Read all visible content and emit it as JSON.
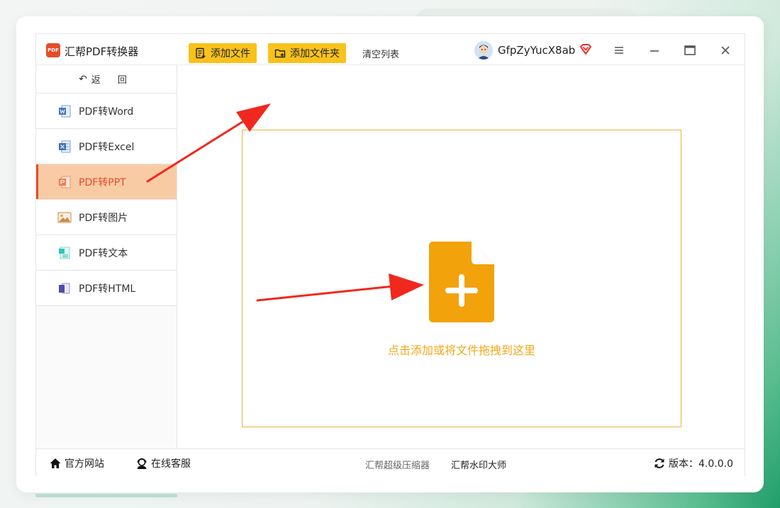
{
  "app": {
    "title": "汇帮PDF转换器",
    "logo_text": "PDF",
    "username": "GfpZyYucX8ab"
  },
  "sidebar": {
    "back_arrow": "↶",
    "back_label": "返 回",
    "items": [
      {
        "label": "PDF转Word",
        "icon": "word-icon",
        "active": false
      },
      {
        "label": "PDF转Excel",
        "icon": "excel-icon",
        "active": false
      },
      {
        "label": "PDF转PPT",
        "icon": "ppt-icon",
        "active": true
      },
      {
        "label": "PDF转图片",
        "icon": "image-icon",
        "active": false
      },
      {
        "label": "PDF转文本",
        "icon": "text-file-icon",
        "active": false
      },
      {
        "label": "PDF转HTML",
        "icon": "html-icon",
        "active": false
      }
    ]
  },
  "toolbar": {
    "add_file_label": "添加文件",
    "add_folder_label": "添加文件夹",
    "clear_label": "清空列表"
  },
  "dropzone": {
    "hint": "点击添加或将文件拖拽到这里"
  },
  "footer": {
    "official_site": "官方网站",
    "online_service": "在线客服",
    "compressor": "汇帮超级压缩器",
    "watermark": "汇帮水印大师",
    "version_label": "版本：4.0.0.0"
  },
  "colors": {
    "accent_yellow": "#f8c21a",
    "active_bg": "#f9cba5",
    "active_text": "#e64b2b",
    "drop_border": "#e8b33b",
    "drop_icon": "#f2a20a",
    "arrow_red": "#f0281e"
  }
}
